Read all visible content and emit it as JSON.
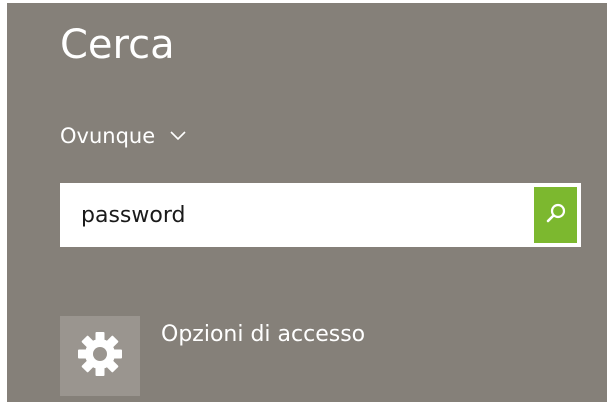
{
  "search_pane": {
    "title": "Cerca",
    "scope": {
      "label": "Ovunque",
      "icon": "chevron-down-icon"
    },
    "search": {
      "value": "password",
      "placeholder": "",
      "button_icon": "search-icon",
      "button_color": "#7cb82f"
    },
    "results": [
      {
        "label": "Opzioni di accesso",
        "icon": "gear-icon"
      }
    ]
  },
  "colors": {
    "panel_background": "#858079",
    "tile_background": "#9a958f",
    "text": "#ffffff"
  }
}
